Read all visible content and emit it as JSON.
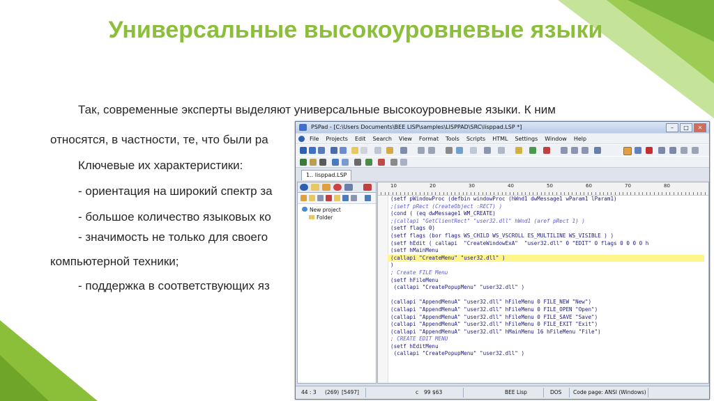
{
  "slide": {
    "title": "Универсальные высокоуровневые языки",
    "paragraphs": [
      "Так, современные эксперты выделяют универсальные высокоуровневые языки. К ним",
      "относятся, в частности, те, что были ра",
      "Ключевые их характеристики:",
      "- ориентация на широкий спектр за",
      "- большое количество языковых ко",
      "- значимость не только для своего",
      "компьютерной техники;",
      "- поддержка в соответствующих яз"
    ],
    "accent_color": "#8bbf3a"
  },
  "window": {
    "title": "PSPad - [C:\\Users                Documents\\BEE LISP\\samples\\LISPPAD\\SRC\\lisppad.LSP *]",
    "controls": [
      "–",
      "□",
      "✕"
    ],
    "menu": [
      "File",
      "Projects",
      "Edit",
      "Search",
      "View",
      "Format",
      "Tools",
      "Scripts",
      "HTML",
      "Settings",
      "Window",
      "Help"
    ],
    "tab": "1.. lisppad.LSP",
    "tree": {
      "project": "New project",
      "folder": "Folder"
    },
    "ruler": [
      "10",
      "20",
      "30",
      "40",
      "50",
      "60",
      "70",
      "80"
    ],
    "code": [
      {
        "t": "(setf pWindowProc (defbin windowProc (hWnd1 dwMessage1 wParam1 lParam1)",
        "k": "n"
      },
      {
        "t": ";(setf pRect (CreateObject :RECT) )",
        "k": "c"
      },
      {
        "t": "(cond ( (eq dwMessage1 WM_CREATE)",
        "k": "n"
      },
      {
        "t": ";(callapi \"GetClientRect\" \"user32.dll\" hWnd1 (aref pRect 1) )",
        "k": "c"
      },
      {
        "t": "(setf flags 0)",
        "k": "n"
      },
      {
        "t": "(setf flags (bor flags WS_CHILD WS_VSCROLL ES_MULTILINE WS_VISIBLE ) )",
        "k": "n"
      },
      {
        "t": "(setf hEdit ( callapi  \"CreateWindowExA\"  \"user32.dll\" 0 \"EDIT\" 0 flags 0 0 0 0 h",
        "k": "n"
      },
      {
        "t": "(setf hMainMenu",
        "k": "n"
      },
      {
        "t": "(callapi \"CreateMenu\" \"user32.dll\" )",
        "k": "h"
      },
      {
        "t": ")",
        "k": "n"
      },
      {
        "t": "; Create FILE Menu",
        "k": "c"
      },
      {
        "t": "(setf hFileMenu",
        "k": "n"
      },
      {
        "t": " (callapi \"CreatePopupMenu\" \"user32.dll\" )",
        "k": "n"
      },
      {
        "t": "",
        "k": "n"
      },
      {
        "t": "(callapi \"AppendMenuA\" \"user32.dll\" hFileMenu 0 FILE_NEW \"New\")",
        "k": "n"
      },
      {
        "t": "(callapi \"AppendMenuA\" \"user32.dll\" hFileMenu 0 FILE_OPEN \"Open\")",
        "k": "n"
      },
      {
        "t": "(callapi \"AppendMenuA\" \"user32.dll\" hFileMenu 0 FILE_SAVE \"Save\")",
        "k": "n"
      },
      {
        "t": "(callapi \"AppendMenuA\" \"user32.dll\" hFileMenu 0 FILE_EXIT \"Exit\")",
        "k": "n"
      },
      {
        "t": "(callapi \"AppendMenuA\" \"user32.dll\" hMainMenu 16 hFileMenu \"File\")",
        "k": "n"
      },
      {
        "t": "; CREATE EDIT MENU",
        "k": "c"
      },
      {
        "t": "(setf hEditMenu",
        "k": "n"
      },
      {
        "t": " (callapi \"CreatePopupMenu\" \"user32.dll\" )",
        "k": "n"
      }
    ],
    "status": {
      "position": "44 : 3",
      "pos2": "(269)",
      "pos3": "[5497]",
      "col": "c",
      "chars": "99 $63",
      "syntax": "BEE Lisp",
      "format": "DOS",
      "codepage": "Code page: ANSI (Windows)"
    }
  }
}
